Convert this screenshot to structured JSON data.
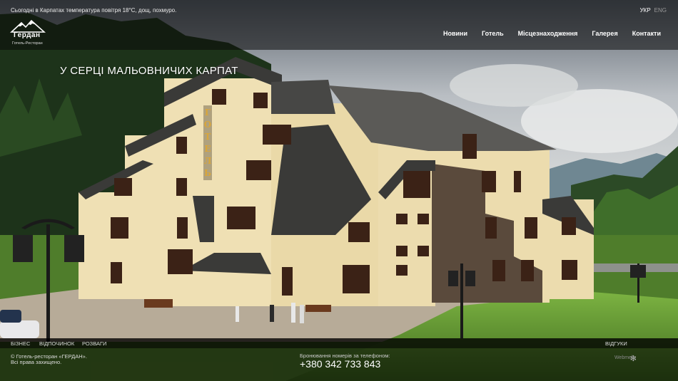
{
  "top_bar": {
    "status": "Сьогодні в Карпатах температура повітря 18°С, дощ, похмуро.",
    "languages": [
      {
        "label": "УКР",
        "active": true
      },
      {
        "label": "ENG",
        "active": false
      }
    ]
  },
  "logo": {
    "name": "Гердан",
    "subtitle": "Готель-Ресторан"
  },
  "nav": {
    "items": [
      "Новини",
      "Готель",
      "Місцезнаходження",
      "Галерея",
      "Контакти"
    ]
  },
  "hero": {
    "title": "У СЕРЦІ МАЛЬОВНИЧИХ КАРПАТ",
    "sign": "ГОТЕЛЬ"
  },
  "categories": {
    "left": [
      "БІЗНЕС",
      "ВІДПОЧИНОК",
      "РОЗВАГИ"
    ],
    "right": "ВІДГУКИ"
  },
  "footer": {
    "copyright_line1": "© Готель-ресторан «ГЕРДАН».",
    "copyright_line2": "Всі права захищено.",
    "phone_label": "Бронювання номерів за телефоном:",
    "phone": "+380 342 733 843",
    "credit": "Webmels"
  },
  "colors": {
    "facade": "#efe0b4",
    "roof": "#3a3a38",
    "forest": "#1f3a1a",
    "grass": "#6fa63a",
    "sky": "#c9cdd0",
    "bar": "#000000"
  }
}
